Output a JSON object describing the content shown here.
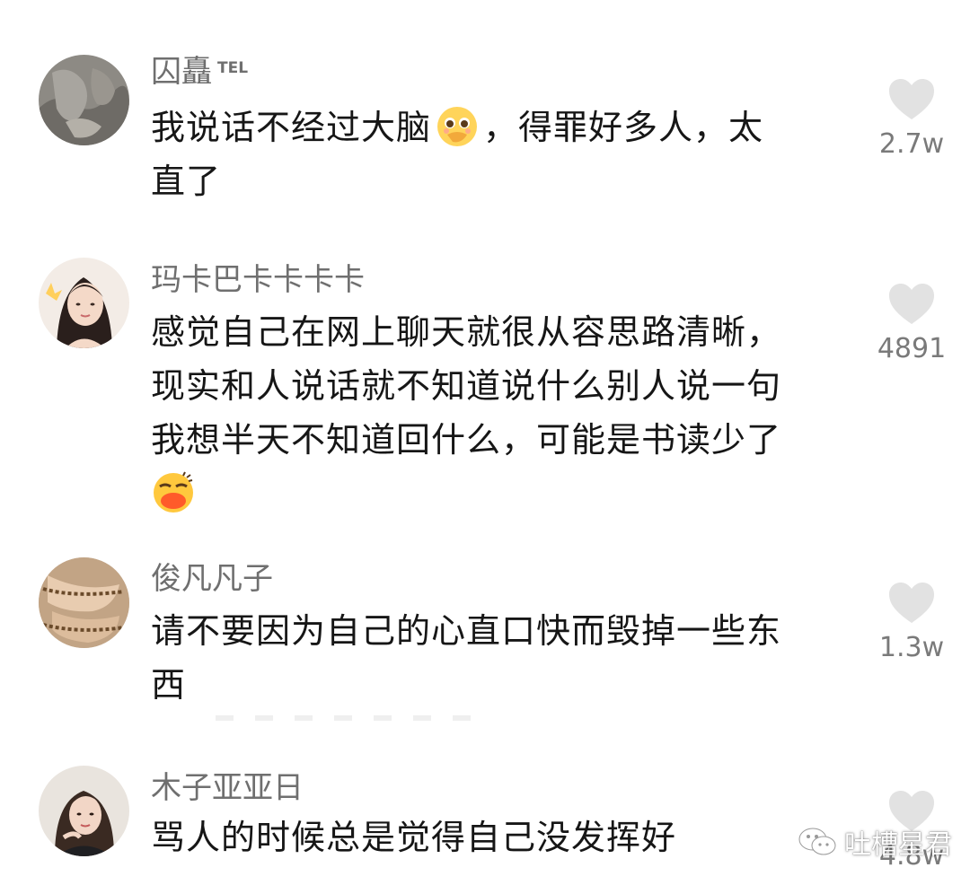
{
  "comments": [
    {
      "username": "囚矗",
      "badge": "TEL",
      "text_before_emoji": "我说话不经过大脑",
      "emoji": "pleading-face-emoji",
      "text_after_emoji": "，得罪好多人，太",
      "text_line2": "直了",
      "likes": "2.7w"
    },
    {
      "username": "玛卡巴卡卡卡卡",
      "lines": [
        "感觉自己在网上聊天就很从容思路清晰，",
        "现实和人说话就不知道说什么别人说一句",
        "我想半天不知道回什么，可能是书读少了"
      ],
      "emoji": "embarrassed-face-emoji",
      "likes": "4891"
    },
    {
      "username": "俊凡凡子",
      "lines": [
        "请不要因为自己的心直口快而毁掉一些东",
        "西"
      ],
      "likes": "1.3w"
    },
    {
      "username": "木子亚亚日",
      "lines": [
        "骂人的时候总是觉得自己没发挥好"
      ],
      "likes": "4.8w"
    }
  ],
  "watermark": {
    "text": "吐槽星君",
    "icon": "wechat-icon"
  },
  "colors": {
    "username": "#6f6f6f",
    "text": "#161616",
    "heart": "#e2e2e2",
    "count": "#7a7a7a"
  }
}
